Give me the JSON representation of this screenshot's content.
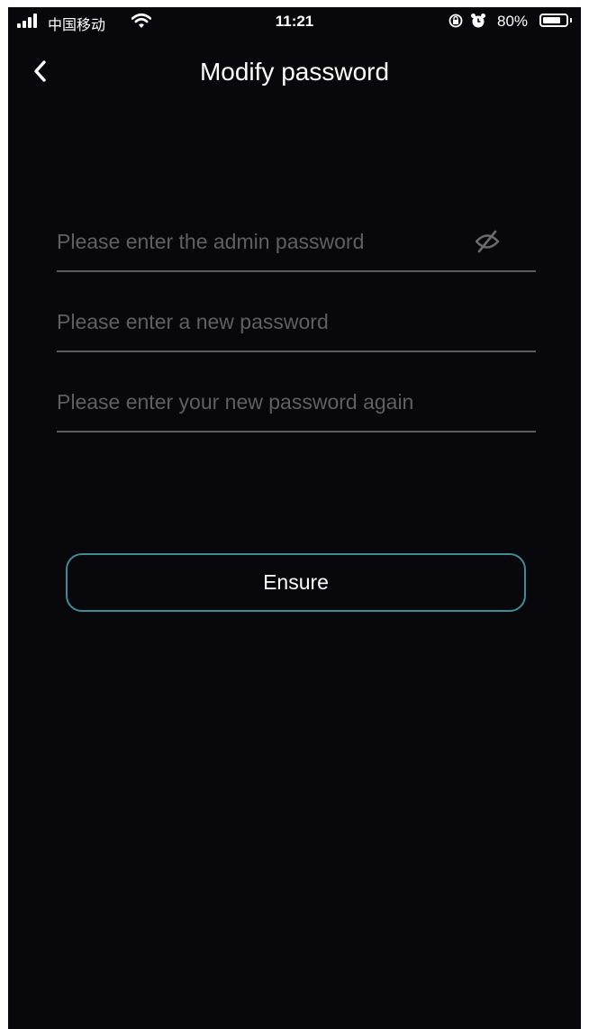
{
  "status_bar": {
    "carrier": "中国移动",
    "time": "11:21",
    "battery_percent_text": "80%",
    "battery_level": 0.8
  },
  "nav": {
    "back_icon": "chevron-left-icon",
    "title": "Modify password"
  },
  "form": {
    "admin_password": {
      "placeholder": "Please enter the admin password",
      "visibility_icon": "eye-off-icon"
    },
    "new_password": {
      "placeholder": "Please enter a new password"
    },
    "confirm_password": {
      "placeholder": "Please enter your new password again"
    },
    "submit_label": "Ensure"
  },
  "colors": {
    "background": "#08070b",
    "text": "#ffffff",
    "placeholder": "#5f5f64",
    "divider": "#5b5b60",
    "button_border": "#3f8d94"
  }
}
